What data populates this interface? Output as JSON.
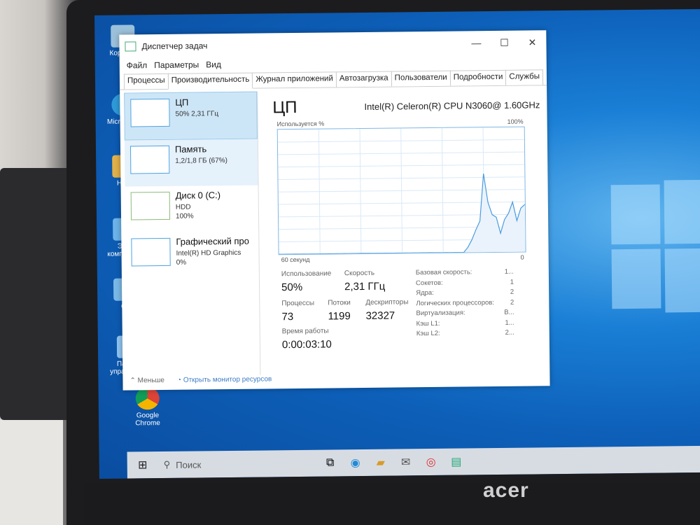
{
  "window": {
    "title": "Диспетчер задач"
  },
  "menu": [
    "Файл",
    "Параметры",
    "Вид"
  ],
  "tabs": [
    "Процессы",
    "Производительность",
    "Журнал приложений",
    "Автозагрузка",
    "Пользователи",
    "Подробности",
    "Службы"
  ],
  "active_tab": "Производительность",
  "sidebar": {
    "items": [
      {
        "label": "ЦП",
        "sub1": "50% 2,31 ГГц",
        "sub2": "",
        "sub3": ""
      },
      {
        "label": "Память",
        "sub1": "1,2/1,8 ГБ (67%)",
        "sub2": "",
        "sub3": ""
      },
      {
        "label": "Диск 0 (C:)",
        "sub1": "HDD",
        "sub2": "100%",
        "sub3": ""
      },
      {
        "label": "Графический про",
        "sub1": "Intel(R) HD Graphics",
        "sub2": "0%",
        "sub3": ""
      }
    ]
  },
  "cpu": {
    "title": "ЦП",
    "model": "Intel(R) Celeron(R) CPU N3060@ 1.60GHz",
    "graph_label": "Используется %",
    "graph_max": "100%",
    "graph_time": "60 секунд",
    "graph_min": "0",
    "usage_label": "Использование",
    "usage_value": "50%",
    "speed_label": "Скорость",
    "speed_value": "2,31 ГГц",
    "processes_label": "Процессы",
    "processes_value": "73",
    "threads_label": "Потоки",
    "threads_value": "1199",
    "handles_label": "Дескрипторы",
    "handles_value": "32327",
    "uptime_label": "Время работы",
    "uptime_value": "0:00:03:10",
    "details": [
      {
        "k": "Базовая скорость:",
        "v": "1..."
      },
      {
        "k": "Сокетов:",
        "v": "1"
      },
      {
        "k": "Ядра:",
        "v": "2"
      },
      {
        "k": "Логических процессоров:",
        "v": "2"
      },
      {
        "k": "Виртуализация:",
        "v": "В..."
      },
      {
        "k": "Кэш L1:",
        "v": "1..."
      },
      {
        "k": "Кэш L2:",
        "v": "2..."
      }
    ]
  },
  "chart_data": {
    "type": "area",
    "ylim": [
      0,
      100
    ],
    "values": [
      0,
      0,
      0,
      0,
      0,
      0,
      0,
      0,
      0,
      0,
      0,
      0,
      0,
      0,
      0,
      0,
      0,
      0,
      0,
      0,
      0,
      0,
      0,
      0,
      0,
      0,
      0,
      0,
      0,
      0,
      0,
      0,
      0,
      0,
      0,
      0,
      0,
      0,
      0,
      0,
      0,
      0,
      0,
      0,
      0,
      0,
      4,
      10,
      18,
      25,
      63,
      40,
      30,
      28,
      15,
      26,
      31,
      40,
      25,
      35,
      38
    ]
  },
  "footer": {
    "less": "Меньше",
    "monitor": "Открыть монитор ресурсов"
  },
  "desktop": {
    "icons": [
      "Корзина",
      "Micr. Edge",
      "Hom",
      "Этот компьютер",
      "Се",
      "Панель управления",
      "Google Chrome"
    ]
  },
  "taskbar": {
    "search_placeholder": "Поиск"
  },
  "brand": "acer"
}
